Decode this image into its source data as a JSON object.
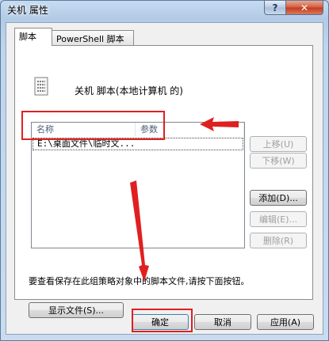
{
  "window": {
    "title": "关机 属性",
    "help_label": "?",
    "close_label": "✕"
  },
  "tabs": [
    {
      "label": "脚本",
      "active": true
    },
    {
      "label": "PowerShell 脚本",
      "active": false
    }
  ],
  "panel": {
    "heading": "关机 脚本(本地计算机 的)",
    "columns": [
      "名称",
      "参数"
    ],
    "rows": [
      {
        "name": "E:\\桌面文件\\临时文...",
        "param": ""
      }
    ],
    "side_buttons": {
      "up": "上移(U)",
      "down": "下移(W)",
      "add": "添加(D)...",
      "edit": "编辑(E)...",
      "remove": "删除(R)"
    },
    "hint": "要查看保存在此组策略对象中的脚本文件,请按下面按钮。",
    "show_files": "显示文件(S)..."
  },
  "footer": {
    "ok": "确定",
    "cancel": "取消",
    "apply": "应用(A)"
  },
  "colors": {
    "annotation": "#e02020"
  },
  "icons": [
    "script-document-icon",
    "help-icon",
    "close-icon"
  ]
}
